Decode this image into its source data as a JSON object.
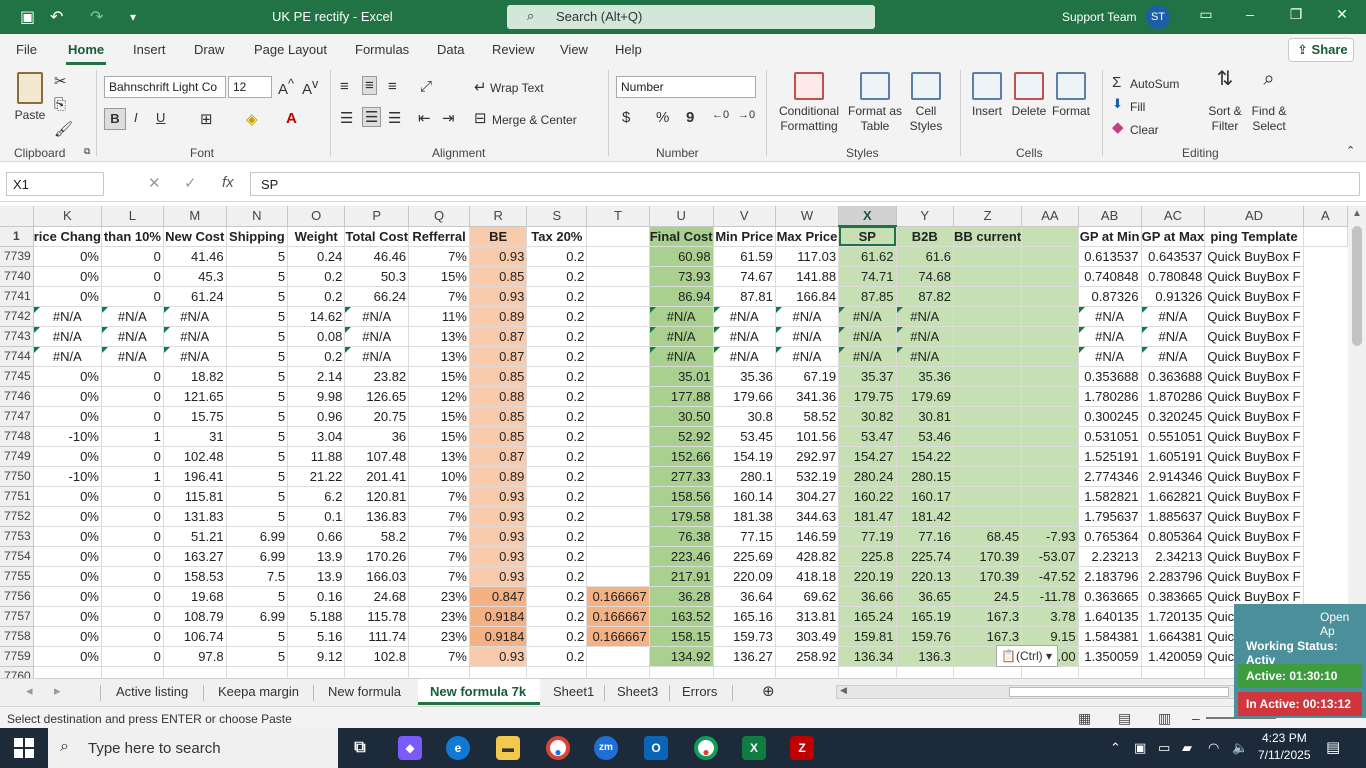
{
  "titlebar": {
    "title": "UK PE rectify  -  Excel",
    "search_placeholder": "Search (Alt+Q)",
    "user_name": "Support Team",
    "user_initials": "ST"
  },
  "menu": [
    "File",
    "Home",
    "Insert",
    "Draw",
    "Page Layout",
    "Formulas",
    "Data",
    "Review",
    "View",
    "Help"
  ],
  "share_label": "Share",
  "ribbon": {
    "groups": {
      "clipboard": "Clipboard",
      "font": "Font",
      "alignment": "Alignment",
      "number": "Number",
      "styles": "Styles",
      "cells": "Cells",
      "editing": "Editing"
    },
    "paste": "Paste",
    "font_name": "Bahnschrift Light Co",
    "font_size": "12",
    "bold": "B",
    "italic": "I",
    "underline": "U",
    "wrap_text": "Wrap Text",
    "merge_center": "Merge & Center",
    "number_format": "Number",
    "conditional_formatting": "Conditional Formatting",
    "format_as_table": "Format as Table",
    "cell_styles": "Cell Styles",
    "insert": "Insert",
    "delete": "Delete",
    "format": "Format",
    "autosum": "AutoSum",
    "fill": "Fill",
    "clear": "Clear",
    "sort_filter": "Sort & Filter",
    "find_select": "Find & Select"
  },
  "formula_bar": {
    "name_box": "X1",
    "formula": "SP",
    "fx": "fx"
  },
  "columns": [
    "K",
    "L",
    "M",
    "N",
    "O",
    "P",
    "Q",
    "R",
    "S",
    "T",
    "U",
    "V",
    "W",
    "X",
    "Y",
    "Z",
    "AA",
    "AB",
    "AC",
    "AD",
    "A"
  ],
  "selected_column": "X",
  "header_row": {
    "row": "1",
    "cells": [
      "rice Chang",
      "than 10%",
      "New Cost",
      "Shipping",
      "Weight",
      "Total Cost",
      "Refferral",
      "BE",
      "Tax 20%",
      "",
      "Final Cost",
      "Min Price",
      "Max Price",
      "SP",
      "B2B",
      "BB current",
      "",
      "GP at Min",
      "GP at Max",
      "ping Template",
      ""
    ]
  },
  "rows": [
    [
      "7739",
      "0%",
      "0",
      "41.46",
      "5",
      "0.24",
      "46.46",
      "7%",
      "0.93",
      "0.2",
      "",
      "60.98",
      "61.59",
      "117.03",
      "61.62",
      "61.6",
      "",
      "",
      "0.613537",
      "0.643537",
      "Quick BuyBox F"
    ],
    [
      "7740",
      "0%",
      "0",
      "45.3",
      "5",
      "0.2",
      "50.3",
      "15%",
      "0.85",
      "0.2",
      "",
      "73.93",
      "74.67",
      "141.88",
      "74.71",
      "74.68",
      "",
      "",
      "0.740848",
      "0.780848",
      "Quick BuyBox F"
    ],
    [
      "7741",
      "0%",
      "0",
      "61.24",
      "5",
      "0.2",
      "66.24",
      "7%",
      "0.93",
      "0.2",
      "",
      "86.94",
      "87.81",
      "166.84",
      "87.85",
      "87.82",
      "",
      "",
      "0.87326",
      "0.91326",
      "Quick BuyBox F"
    ],
    [
      "7742",
      "#N/A",
      "#N/A",
      "#N/A",
      "5",
      "14.62",
      "#N/A",
      "11%",
      "0.89",
      "0.2",
      "",
      "#N/A",
      "#N/A",
      "#N/A",
      "#N/A",
      "#N/A",
      "",
      "",
      "#N/A",
      "#N/A",
      "Quick BuyBox F"
    ],
    [
      "7743",
      "#N/A",
      "#N/A",
      "#N/A",
      "5",
      "0.08",
      "#N/A",
      "13%",
      "0.87",
      "0.2",
      "",
      "#N/A",
      "#N/A",
      "#N/A",
      "#N/A",
      "#N/A",
      "",
      "",
      "#N/A",
      "#N/A",
      "Quick BuyBox F"
    ],
    [
      "7744",
      "#N/A",
      "#N/A",
      "#N/A",
      "5",
      "0.2",
      "#N/A",
      "13%",
      "0.87",
      "0.2",
      "",
      "#N/A",
      "#N/A",
      "#N/A",
      "#N/A",
      "#N/A",
      "",
      "",
      "#N/A",
      "#N/A",
      "Quick BuyBox F"
    ],
    [
      "7745",
      "0%",
      "0",
      "18.82",
      "5",
      "2.14",
      "23.82",
      "15%",
      "0.85",
      "0.2",
      "",
      "35.01",
      "35.36",
      "67.19",
      "35.37",
      "35.36",
      "",
      "",
      "0.353688",
      "0.363688",
      "Quick BuyBox F"
    ],
    [
      "7746",
      "0%",
      "0",
      "121.65",
      "5",
      "9.98",
      "126.65",
      "12%",
      "0.88",
      "0.2",
      "",
      "177.88",
      "179.66",
      "341.36",
      "179.75",
      "179.69",
      "",
      "",
      "1.780286",
      "1.870286",
      "Quick BuyBox F"
    ],
    [
      "7747",
      "0%",
      "0",
      "15.75",
      "5",
      "0.96",
      "20.75",
      "15%",
      "0.85",
      "0.2",
      "",
      "30.50",
      "30.8",
      "58.52",
      "30.82",
      "30.81",
      "",
      "",
      "0.300245",
      "0.320245",
      "Quick BuyBox F"
    ],
    [
      "7748",
      "-10%",
      "1",
      "31",
      "5",
      "3.04",
      "36",
      "15%",
      "0.85",
      "0.2",
      "",
      "52.92",
      "53.45",
      "101.56",
      "53.47",
      "53.46",
      "",
      "",
      "0.531051",
      "0.551051",
      "Quick BuyBox F"
    ],
    [
      "7749",
      "0%",
      "0",
      "102.48",
      "5",
      "11.88",
      "107.48",
      "13%",
      "0.87",
      "0.2",
      "",
      "152.66",
      "154.19",
      "292.97",
      "154.27",
      "154.22",
      "",
      "",
      "1.525191",
      "1.605191",
      "Quick BuyBox F"
    ],
    [
      "7750",
      "-10%",
      "1",
      "196.41",
      "5",
      "21.22",
      "201.41",
      "10%",
      "0.89",
      "0.2",
      "",
      "277.33",
      "280.1",
      "532.19",
      "280.24",
      "280.15",
      "",
      "",
      "2.774346",
      "2.914346",
      "Quick BuyBox F"
    ],
    [
      "7751",
      "0%",
      "0",
      "115.81",
      "5",
      "6.2",
      "120.81",
      "7%",
      "0.93",
      "0.2",
      "",
      "158.56",
      "160.14",
      "304.27",
      "160.22",
      "160.17",
      "",
      "",
      "1.582821",
      "1.662821",
      "Quick BuyBox F"
    ],
    [
      "7752",
      "0%",
      "0",
      "131.83",
      "5",
      "0.1",
      "136.83",
      "7%",
      "0.93",
      "0.2",
      "",
      "179.58",
      "181.38",
      "344.63",
      "181.47",
      "181.42",
      "",
      "",
      "1.795637",
      "1.885637",
      "Quick BuyBox F"
    ],
    [
      "7753",
      "0%",
      "0",
      "51.21",
      "6.99",
      "0.66",
      "58.2",
      "7%",
      "0.93",
      "0.2",
      "",
      "76.38",
      "77.15",
      "146.59",
      "77.19",
      "77.16",
      "68.45",
      "-7.93",
      "0.765364",
      "0.805364",
      "Quick BuyBox F"
    ],
    [
      "7754",
      "0%",
      "0",
      "163.27",
      "6.99",
      "13.9",
      "170.26",
      "7%",
      "0.93",
      "0.2",
      "",
      "223.46",
      "225.69",
      "428.82",
      "225.8",
      "225.74",
      "170.39",
      "-53.07",
      "2.23213",
      "2.34213",
      "Quick BuyBox F"
    ],
    [
      "7755",
      "0%",
      "0",
      "158.53",
      "7.5",
      "13.9",
      "166.03",
      "7%",
      "0.93",
      "0.2",
      "",
      "217.91",
      "220.09",
      "418.18",
      "220.19",
      "220.13",
      "170.39",
      "-47.52",
      "2.183796",
      "2.283796",
      "Quick BuyBox F"
    ],
    [
      "7756",
      "0%",
      "0",
      "19.68",
      "5",
      "0.16",
      "24.68",
      "23%",
      "0.847",
      "0.2",
      "0.166667",
      "36.28",
      "36.64",
      "69.62",
      "36.66",
      "36.65",
      "24.5",
      "-11.78",
      "0.363665",
      "0.383665",
      "Quick BuyBox F"
    ],
    [
      "7757",
      "0%",
      "0",
      "108.79",
      "6.99",
      "5.188",
      "115.78",
      "23%",
      "0.9184",
      "0.2",
      "0.166667",
      "163.52",
      "165.16",
      "313.81",
      "165.24",
      "165.19",
      "167.3",
      "3.78",
      "1.640135",
      "1.720135",
      "Quick BuyBox F"
    ],
    [
      "7758",
      "0%",
      "0",
      "106.74",
      "5",
      "5.16",
      "111.74",
      "23%",
      "0.9184",
      "0.2",
      "0.166667",
      "158.15",
      "159.73",
      "303.49",
      "159.81",
      "159.76",
      "167.3",
      "9.15",
      "1.584381",
      "1.664381",
      "Quick BuyBox F"
    ],
    [
      "7759",
      "0%",
      "0",
      "97.8",
      "5",
      "9.12",
      "102.8",
      "7%",
      "0.93",
      "0.2",
      "",
      "134.92",
      "136.27",
      "258.92",
      "136.34",
      "136.3",
      "",
      "-3.00",
      "1.350059",
      "1.420059",
      "Quick BuyBox F"
    ],
    [
      "7760",
      "",
      "",
      "",
      "",
      "",
      "",
      "",
      "",
      "",
      "",
      "",
      "",
      "",
      "",
      "",
      "",
      "",
      "",
      "",
      ""
    ]
  ],
  "sheet_tabs": [
    "Active listing",
    "Keepa margin",
    "New formula",
    "New formula 7k",
    "Sheet1",
    "Sheet3",
    "Errors"
  ],
  "active_sheet": "New formula 7k",
  "status_text": "Select destination and press ENTER or choose Paste",
  "paste_options": "(Ctrl)",
  "tracker": {
    "open_label": "Open Ap",
    "status": "Working Status: Activ",
    "active": "Active: 01:30:10",
    "inactive": "In Active: 00:13:12"
  },
  "taskbar": {
    "search_placeholder": "Type here to search",
    "time": "4:23 PM",
    "date": "7/11/2025"
  },
  "colors": {
    "excel_green": "#217346",
    "be_fill": "#f8cbad",
    "green_fill": "#a9d08e",
    "light_green_fill": "#c6e0b4",
    "orange_fill": "#f4b183"
  }
}
